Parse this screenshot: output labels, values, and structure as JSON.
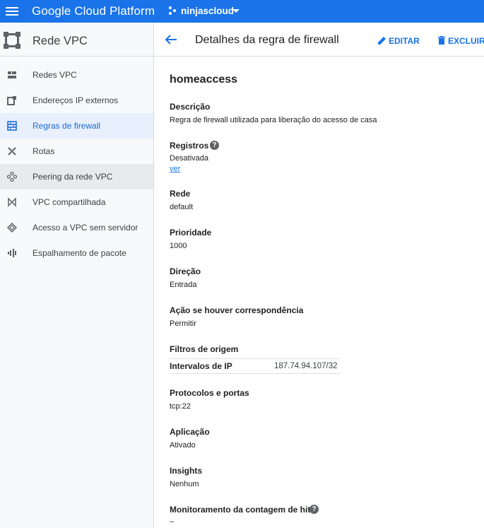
{
  "topbar": {
    "brand": "Google Cloud Platform",
    "project": "ninjascloud"
  },
  "sidebar": {
    "title": "Rede VPC",
    "items": [
      {
        "label": "Redes VPC",
        "icon": "vpc-networks-icon"
      },
      {
        "label": "Endereços IP externos",
        "icon": "external-ip-icon"
      },
      {
        "label": "Regras de firewall",
        "icon": "firewall-icon",
        "active": true
      },
      {
        "label": "Rotas",
        "icon": "routes-icon"
      },
      {
        "label": "Peering da rede VPC",
        "icon": "peering-icon",
        "hover": true
      },
      {
        "label": "VPC compartilhada",
        "icon": "shared-vpc-icon"
      },
      {
        "label": "Acesso a VPC sem servidor",
        "icon": "serverless-access-icon"
      },
      {
        "label": "Espalhamento de pacote",
        "icon": "packet-mirroring-icon"
      }
    ]
  },
  "header": {
    "title": "Detalhes da regra de firewall",
    "edit_label": "EDITAR",
    "delete_label": "EXCLUIR"
  },
  "rule": {
    "name": "homeaccess",
    "description_label": "Descrição",
    "description_value": "Regra de firewall utilizada para liberação do acesso de casa",
    "logs_label": "Registros",
    "logs_value": "Desativada",
    "logs_link": "ver",
    "network_label": "Rede",
    "network_value": "default",
    "priority_label": "Prioridade",
    "priority_value": "1000",
    "direction_label": "Direção",
    "direction_value": "Entrada",
    "action_label": "Ação se houver correspondência",
    "action_value": "Permitir",
    "source_filters_label": "Filtros de origem",
    "ip_ranges_label": "Intervalos de IP",
    "ip_ranges_value": "187.74.94.107/32",
    "protocols_label": "Protocolos e portas",
    "protocols_value": "tcp:22",
    "enforcement_label": "Aplicação",
    "enforcement_value": "Ativado",
    "insights_label": "Insights",
    "insights_value": "Nenhum",
    "hit_count_label": "Monitoramento da contagem de hits",
    "hit_count_value": "–"
  }
}
